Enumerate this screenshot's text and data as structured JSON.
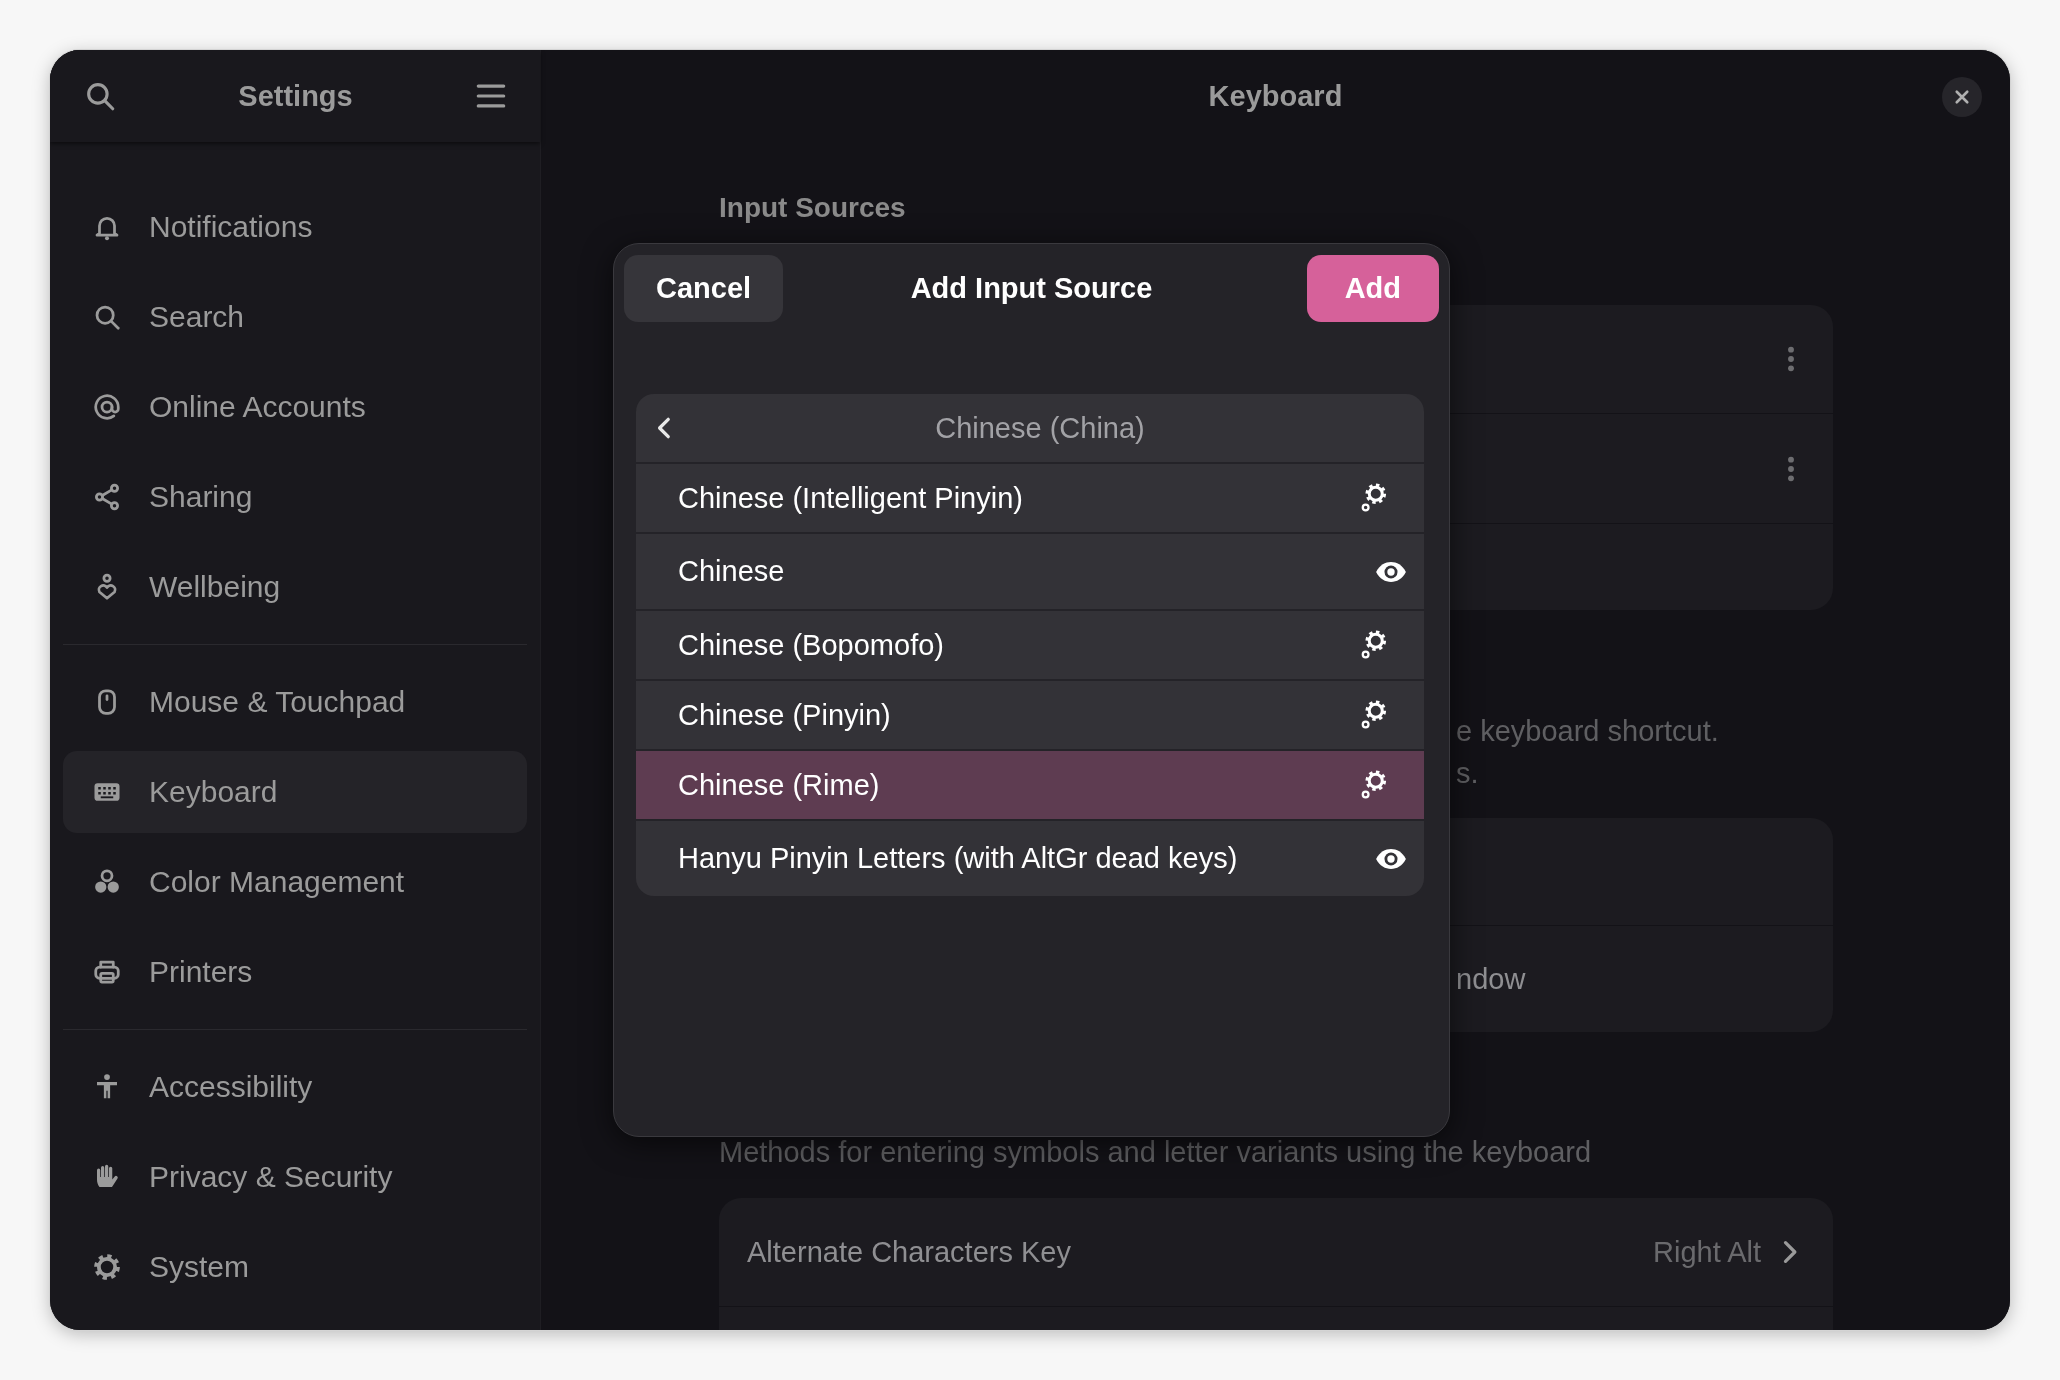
{
  "sidebar": {
    "title": "Settings",
    "sections": [
      {
        "items": [
          {
            "label": "Notifications",
            "selected": false
          },
          {
            "label": "Search",
            "selected": false
          },
          {
            "label": "Online Accounts",
            "selected": false
          },
          {
            "label": "Sharing",
            "selected": false
          },
          {
            "label": "Wellbeing",
            "selected": false
          }
        ]
      },
      {
        "items": [
          {
            "label": "Mouse & Touchpad",
            "selected": false
          },
          {
            "label": "Keyboard",
            "selected": true
          },
          {
            "label": "Color Management",
            "selected": false
          },
          {
            "label": "Printers",
            "selected": false
          }
        ]
      },
      {
        "items": [
          {
            "label": "Accessibility",
            "selected": false
          },
          {
            "label": "Privacy & Security",
            "selected": false
          },
          {
            "label": "System",
            "selected": false
          }
        ]
      }
    ]
  },
  "panel": {
    "title": "Keyboard",
    "input_sources": {
      "heading": "Input Sources",
      "rows": [
        {
          "kind": "source"
        },
        {
          "kind": "source"
        },
        {
          "kind": "plain"
        }
      ]
    },
    "switching": {
      "hint_lines": [
        "e keyboard shortcut.",
        "s."
      ],
      "rows": [
        {
          "kind": "plain"
        },
        {
          "kind": "text",
          "label": "ndow"
        }
      ]
    },
    "special_characters": {
      "description": "Methods for entering symbols and letter variants using the keyboard",
      "rows": [
        {
          "label": "Alternate Characters Key",
          "value": "Right Alt"
        }
      ]
    }
  },
  "dialog": {
    "cancel": "Cancel",
    "title": "Add Input Source",
    "add": "Add",
    "list": {
      "header": "Chinese (China)",
      "items": [
        {
          "label": "Chinese (Intelligent Pinyin)",
          "kind": "engine",
          "selected": false
        },
        {
          "label": "Chinese",
          "kind": "layout",
          "selected": false
        },
        {
          "label": "Chinese (Bopomofo)",
          "kind": "engine",
          "selected": false
        },
        {
          "label": "Chinese (Pinyin)",
          "kind": "engine",
          "selected": false
        },
        {
          "label": "Chinese (Rime)",
          "kind": "engine",
          "selected": true
        },
        {
          "label": "Hanyu Pinyin Letters (with AltGr dead keys)",
          "kind": "layout",
          "selected": false
        }
      ]
    }
  }
}
